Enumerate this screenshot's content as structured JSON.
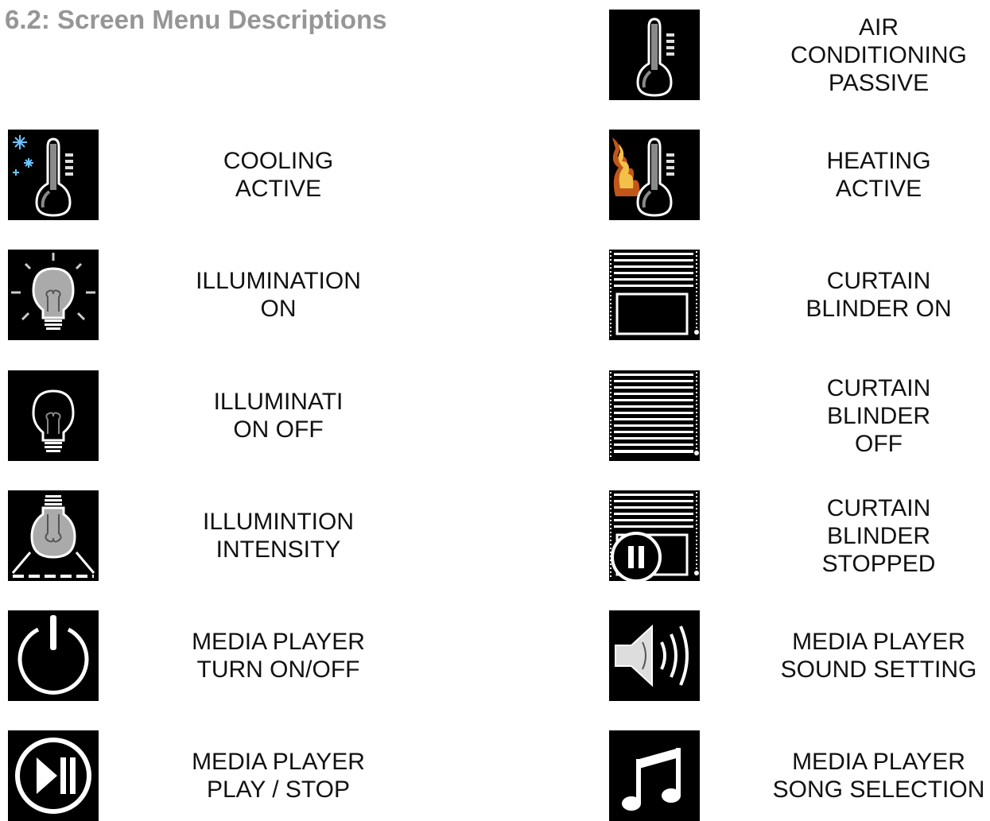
{
  "heading": "6.2: Screen Menu Descriptions",
  "items": [
    {
      "label": "AIR\nCONDITIONING\nPASSIVE",
      "icon": "thermometer-icon"
    },
    {
      "label": "COOLING\nACTIVE",
      "icon": "cooling-thermometer-icon"
    },
    {
      "label": "HEATING\nACTIVE",
      "icon": "heating-thermometer-icon"
    },
    {
      "label": "ILLUMINATION\nON",
      "icon": "light-bulb-on-icon"
    },
    {
      "label": "CURTAIN\nBLINDER ON",
      "icon": "blinds-open-icon"
    },
    {
      "label": "ILLUMINATI\nON OFF",
      "icon": "light-bulb-off-icon"
    },
    {
      "label": "CURTAIN\nBLINDER\nOFF",
      "icon": "blinds-closed-icon"
    },
    {
      "label": "ILLUMINTION\nINTENSITY",
      "icon": "light-intensity-icon"
    },
    {
      "label": "CURTAIN\nBLINDER\nSTOPPED",
      "icon": "blinds-paused-icon"
    },
    {
      "label": "MEDIA PLAYER\nTURN ON/OFF",
      "icon": "power-icon"
    },
    {
      "label": "MEDIA PLAYER\nSOUND SETTING",
      "icon": "speaker-icon"
    },
    {
      "label": "MEDIA PLAYER\nPLAY / STOP",
      "icon": "play-pause-icon"
    },
    {
      "label": "MEDIA PLAYER\nSONG SELECTION",
      "icon": "music-note-icon"
    }
  ]
}
